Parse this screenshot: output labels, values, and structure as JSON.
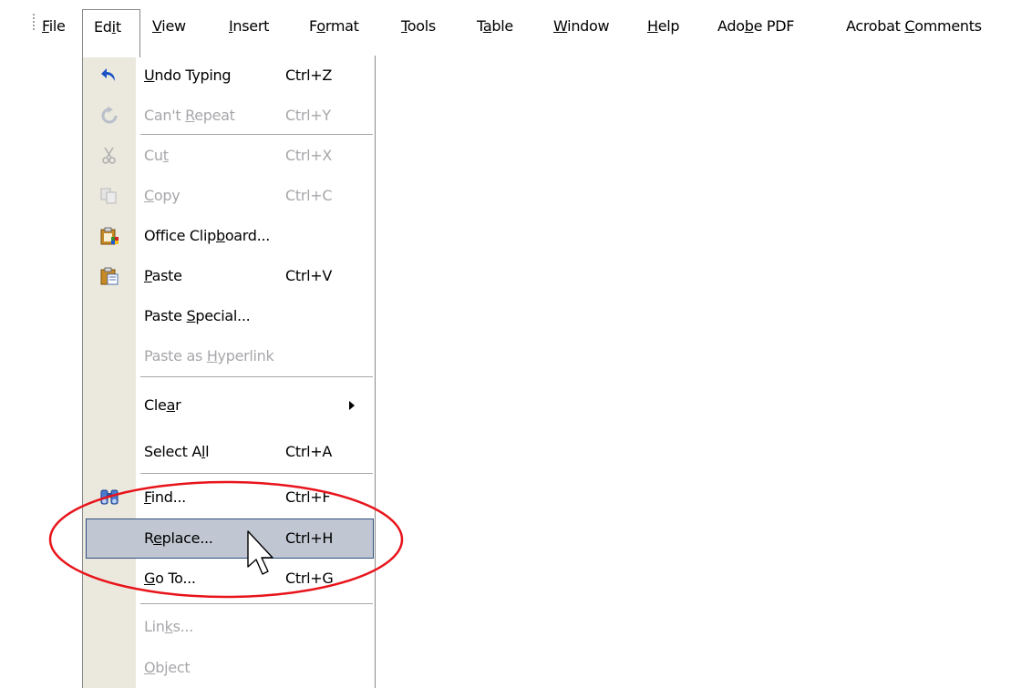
{
  "menubar": {
    "items": [
      {
        "before": "",
        "mnemonic": "F",
        "after": "ile"
      },
      {
        "before": "Ed",
        "mnemonic": "i",
        "after": "t"
      },
      {
        "before": "",
        "mnemonic": "V",
        "after": "iew"
      },
      {
        "before": "",
        "mnemonic": "I",
        "after": "nsert"
      },
      {
        "before": "F",
        "mnemonic": "o",
        "after": "rmat"
      },
      {
        "before": "",
        "mnemonic": "T",
        "after": "ools"
      },
      {
        "before": "T",
        "mnemonic": "a",
        "after": "ble"
      },
      {
        "before": "",
        "mnemonic": "W",
        "after": "indow"
      },
      {
        "before": "",
        "mnemonic": "H",
        "after": "elp"
      },
      {
        "before": "Ado",
        "mnemonic": "b",
        "after": "e PDF"
      },
      {
        "before": "Acrobat ",
        "mnemonic": "C",
        "after": "omments"
      }
    ]
  },
  "edit_menu": {
    "items": [
      {
        "before": "",
        "mnemonic": "U",
        "after": "ndo Typing",
        "shortcut": "Ctrl+Z",
        "icon": "undo-icon"
      },
      {
        "before": "Can't ",
        "mnemonic": "R",
        "after": "epeat",
        "shortcut": "Ctrl+Y",
        "icon": "repeat-icon"
      },
      {
        "before": "Cu",
        "mnemonic": "t",
        "after": "",
        "shortcut": "Ctrl+X",
        "icon": "cut-icon"
      },
      {
        "before": "",
        "mnemonic": "C",
        "after": "opy",
        "shortcut": "Ctrl+C",
        "icon": "copy-icon"
      },
      {
        "before": "Office Clip",
        "mnemonic": "b",
        "after": "oard...",
        "shortcut": "",
        "icon": "office-clipboard-icon"
      },
      {
        "before": "",
        "mnemonic": "P",
        "after": "aste",
        "shortcut": "Ctrl+V",
        "icon": "paste-icon"
      },
      {
        "before": "Paste ",
        "mnemonic": "S",
        "after": "pecial...",
        "shortcut": ""
      },
      {
        "before": "Paste as ",
        "mnemonic": "H",
        "after": "yperlink",
        "shortcut": ""
      },
      {
        "before": "Cle",
        "mnemonic": "a",
        "after": "r",
        "shortcut": ""
      },
      {
        "before": "Select A",
        "mnemonic": "l",
        "after": "l",
        "shortcut": "Ctrl+A"
      },
      {
        "before": "",
        "mnemonic": "F",
        "after": "ind...",
        "shortcut": "Ctrl+F",
        "icon": "find-binoculars-icon"
      },
      {
        "before": "R",
        "mnemonic": "e",
        "after": "place...",
        "shortcut": "Ctrl+H"
      },
      {
        "before": "",
        "mnemonic": "G",
        "after": "o To...",
        "shortcut": "Ctrl+G"
      },
      {
        "before": "Lin",
        "mnemonic": "k",
        "after": "s...",
        "shortcut": ""
      },
      {
        "before": "",
        "mnemonic": "O",
        "after": "bject",
        "shortcut": ""
      }
    ]
  },
  "colors": {
    "menu_gutter": "#ebe8dd",
    "highlight_fill": "#c1c7d2",
    "highlight_border": "#2f4f7f",
    "disabled_text": "#a7a6aa",
    "annotation_ellipse": "#e8141b"
  }
}
